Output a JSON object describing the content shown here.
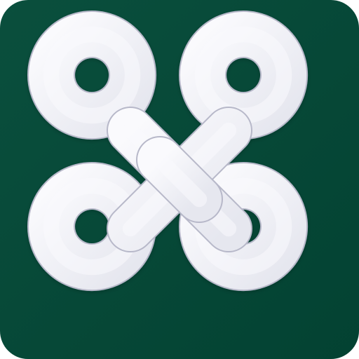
{
  "icon": {
    "name": "celtic-knot-icon",
    "colors": {
      "background_top": "#0a4f3d",
      "background_bottom": "#034232",
      "knot_light": "#fafafd",
      "knot_mid": "#e6e7ef",
      "knot_shadow": "#c9cad8",
      "knot_edge": "#b7b8c9"
    }
  }
}
